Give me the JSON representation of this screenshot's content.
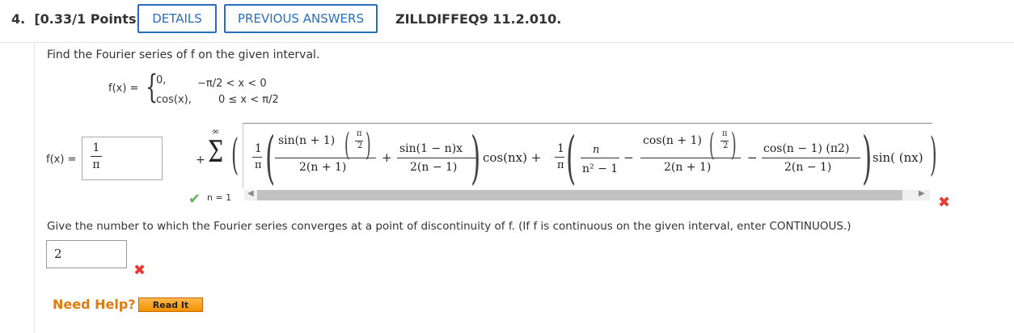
{
  "header": {
    "question_number": "4.",
    "points": "[0.33/1 Points]",
    "details_label": "DETAILS",
    "previous_answers_label": "PREVIOUS ANSWERS",
    "problem_code": "ZILLDIFFEQ9 11.2.010."
  },
  "prompt": "Find the Fourier series of f on the given interval.",
  "function_def": {
    "lhs": "f(x) =",
    "case1_value": "0,",
    "case1_range": "−π/2  < x < 0",
    "case2_value": "cos(x),",
    "case2_range": "0  ≤ x < π/2"
  },
  "series": {
    "lhs": "f(x) =",
    "answer_num": "1",
    "answer_den": "π",
    "plus": "+",
    "sigma": "Σ",
    "sum_upper": "∞",
    "sum_lower": "n = 1",
    "term1_coef_num": "1",
    "term1_coef_den": "π",
    "frac1_num": "sin(n + 1)",
    "frac1_den": "2(n + 1)",
    "frac2_num": "sin(1 − n)x",
    "frac2_den": "2(n − 1)",
    "cos_part": "cos(nx) +",
    "term2_coef_num": "1",
    "term2_coef_den": "π",
    "frac3_num": "n",
    "frac3_den": "n² − 1",
    "minus1": "−",
    "frac4_num": "cos(n + 1)",
    "frac4_den": "2(n + 1)",
    "minus2": "−",
    "frac5_num": "cos(n − 1) (π2)",
    "frac5_den": "2(n − 1)",
    "sin_part": "sin( (nx)",
    "pi_over_2_num": "π",
    "pi_over_2_den": "2",
    "closing_paren": ")"
  },
  "question2": "Give the number to which the Fourier series converges at a point of discontinuity of f. (If f is continuous on the given interval, enter CONTINUOUS.)",
  "answer2": "2",
  "need_help_label": "Need Help?",
  "read_it_label": "Read It",
  "colors": {
    "accent_blue": "#2a6ebd",
    "correct_green": "#5cb85c",
    "incorrect_red": "#e53935",
    "help_orange": "#e07a10"
  },
  "icons": {
    "check": "✔",
    "cross": "✖",
    "scroll_left": "◀",
    "scroll_right": "▶"
  }
}
